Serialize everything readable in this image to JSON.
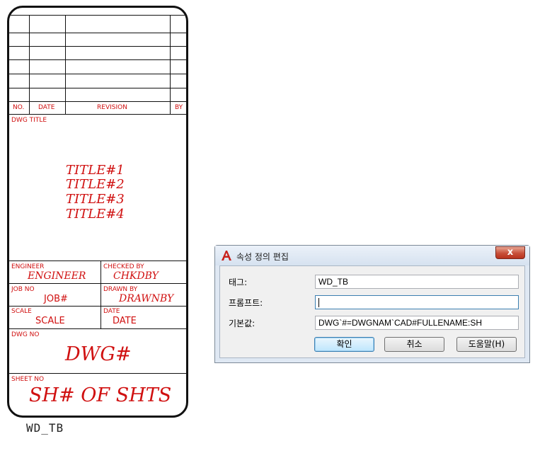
{
  "title_block": {
    "headers": {
      "no": "NO.",
      "date": "DATE",
      "revision": "REVISION",
      "by": "BY"
    },
    "dwg_title_label": "DWG TITLE",
    "titles": [
      "TITLE#1",
      "TITLE#2",
      "TITLE#3",
      "TITLE#4"
    ],
    "engineer": {
      "label": "ENGINEER",
      "value": "ENGINEER"
    },
    "checked_by": {
      "label": "CHECKED BY",
      "value": "CHKDBY"
    },
    "job_no": {
      "label": "JOB NO",
      "value": "JOB#"
    },
    "drawn_by": {
      "label": "DRAWN BY",
      "value": "DRAWNBY"
    },
    "scale": {
      "label": "SCALE",
      "value": "SCALE"
    },
    "date": {
      "label": "DATE",
      "value": "DATE"
    },
    "dwg_no": {
      "label": "DWG NO",
      "value": "DWG#"
    },
    "sheet_no": {
      "label": "SHEET NO",
      "value": "SH# OF SHTS"
    },
    "block_name": "WD_TB",
    "text_color": "#d01010"
  },
  "dialog": {
    "title": "속성 정의 편집",
    "close_glyph": "x",
    "icon": "autocad-a-icon",
    "fields": {
      "tag": {
        "label": "태그:",
        "value": "WD_TB"
      },
      "prompt": {
        "label": "프롬프트:",
        "value": ""
      },
      "default": {
        "label": "기본값:",
        "value": "DWG`#=DWGNAM`CAD#FULLENAME:SH"
      }
    },
    "buttons": {
      "ok": "확인",
      "cancel": "취소",
      "help": "도움말(H)"
    }
  }
}
